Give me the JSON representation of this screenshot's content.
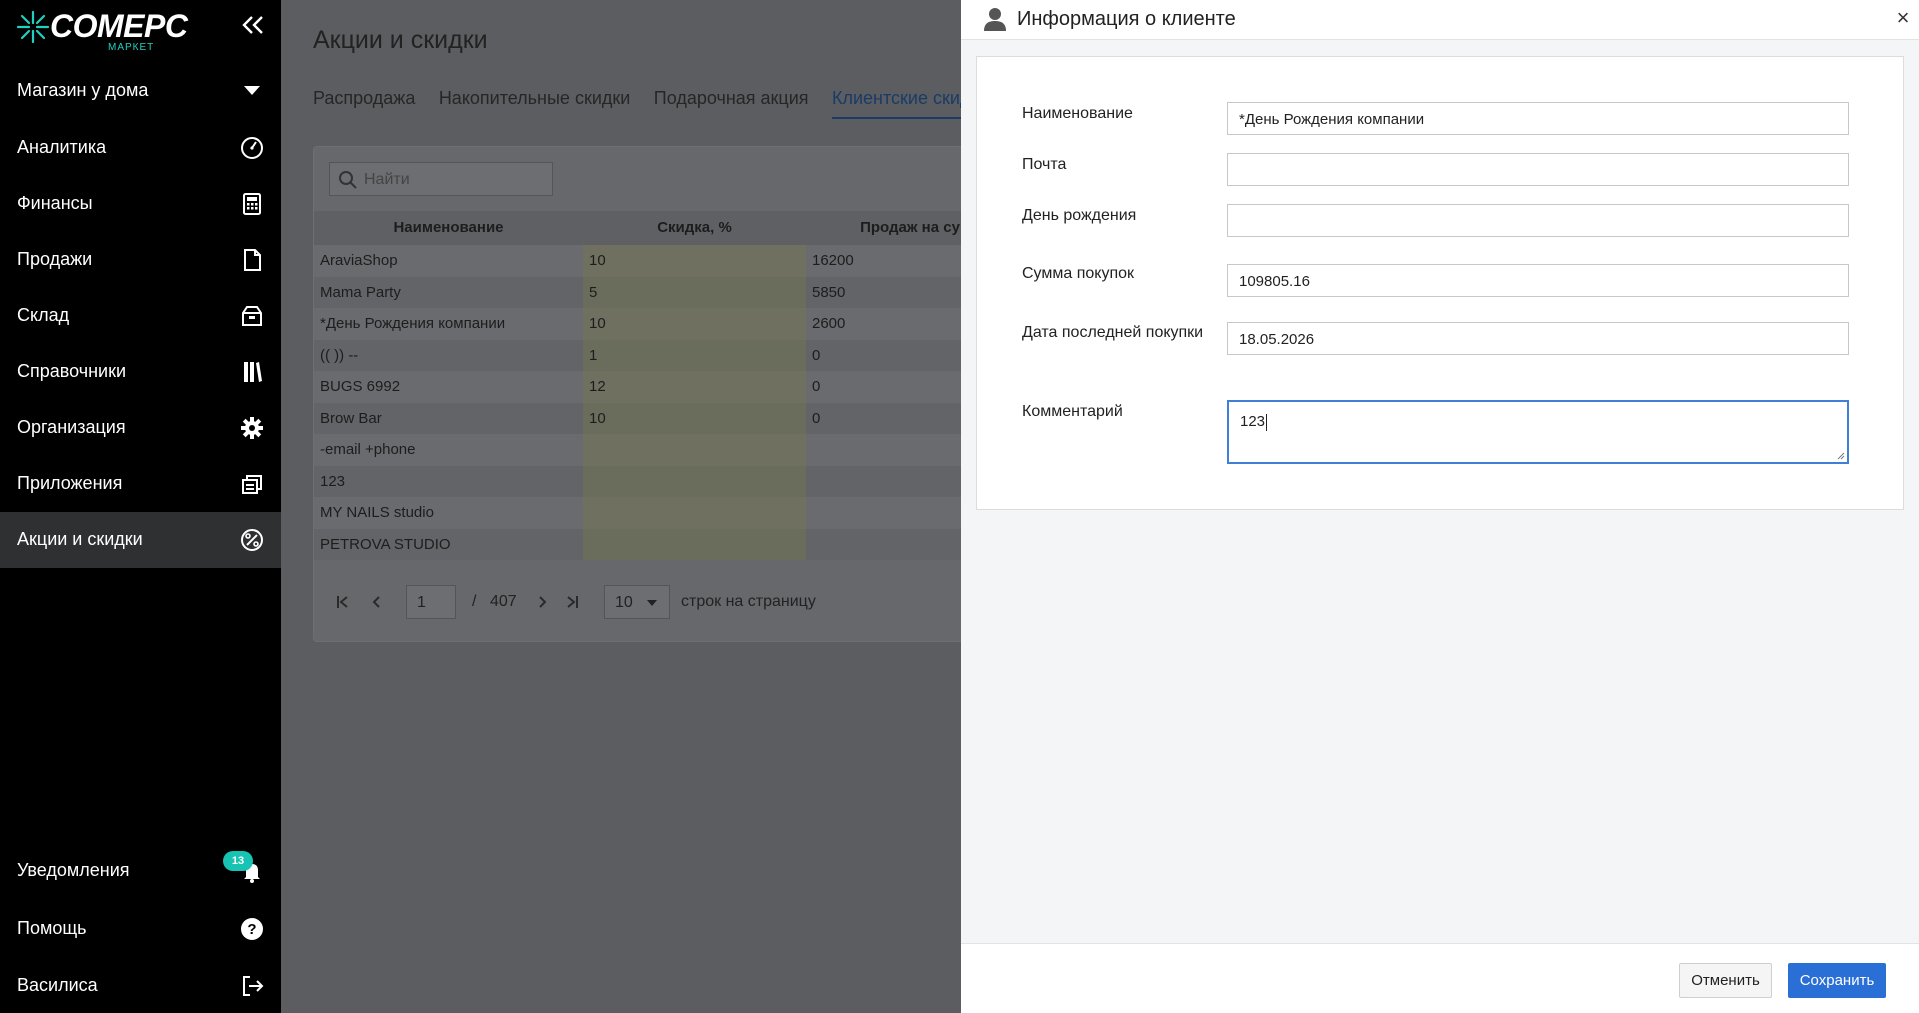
{
  "logo": {
    "brand": "COMEPC",
    "sub": "МАРКЕТ"
  },
  "sidebar": {
    "store": "Магазин у дома",
    "items": [
      {
        "label": "Аналитика",
        "icon": "gauge-icon"
      },
      {
        "label": "Финансы",
        "icon": "calculator-icon"
      },
      {
        "label": "Продажи",
        "icon": "document-icon"
      },
      {
        "label": "Склад",
        "icon": "box-icon"
      },
      {
        "label": "Справочники",
        "icon": "books-icon"
      },
      {
        "label": "Организация",
        "icon": "gear-icon"
      },
      {
        "label": "Приложения",
        "icon": "windows-icon"
      },
      {
        "label": "Акции и скидки",
        "icon": "percent-icon"
      }
    ],
    "bottom": [
      {
        "label": "Уведомления",
        "icon": "bell-icon",
        "badge": "13"
      },
      {
        "label": "Помощь",
        "icon": "help-icon"
      },
      {
        "label": "Василиса",
        "icon": "logout-icon"
      }
    ]
  },
  "main": {
    "title": "Акции и скидки",
    "tabs": [
      "Распродажа",
      "Накопительные скидки",
      "Подарочная акция",
      "Клиентские скидки"
    ],
    "active_tab": 3,
    "search_placeholder": "Найти",
    "columns": [
      "Наименование",
      "Скидка, %",
      "Продаж на су"
    ],
    "rows": [
      {
        "name": "AraviaShop",
        "discount": "10",
        "sales": "16200"
      },
      {
        "name": "Mama Party",
        "discount": "5",
        "sales": "5850"
      },
      {
        "name": "*День Рождения компании",
        "discount": "10",
        "sales": "2600"
      },
      {
        "name": "(( )) --",
        "discount": "1",
        "sales": "0"
      },
      {
        "name": "BUGS 6992",
        "discount": "12",
        "sales": "0"
      },
      {
        "name": "Brow Bar",
        "discount": "10",
        "sales": "0"
      },
      {
        "name": "-email +phone",
        "discount": "",
        "sales": ""
      },
      {
        "name": "123",
        "discount": "",
        "sales": ""
      },
      {
        "name": "MY NAILS studio",
        "discount": "",
        "sales": ""
      },
      {
        "name": "PETROVA STUDIO",
        "discount": "",
        "sales": ""
      }
    ],
    "pager": {
      "page": "1",
      "separator": "/",
      "total": "407",
      "per_page": "10",
      "per_page_label": "строк на страницу"
    }
  },
  "modal": {
    "title": "Информация о клиенте",
    "close": "×",
    "fields": {
      "name_label": "Наименование",
      "name_value": "*День Рождения компании",
      "email_label": "Почта",
      "email_value": "",
      "birthday_label": "День рождения",
      "birthday_value": "",
      "total_label": "Сумма покупок",
      "total_value": "109805.16",
      "last_label": "Дата последней покупки",
      "last_value": "18.05.2026",
      "comment_label": "Комментарий",
      "comment_value": "123"
    },
    "cancel": "Отменить",
    "save": "Сохранить"
  },
  "colors": {
    "sidebar_bg": "#000000",
    "active_bg": "#2f3032",
    "accent": "#2a6fd6",
    "badge": "#17c3b2",
    "brand_sub": "#1fd1c0"
  }
}
